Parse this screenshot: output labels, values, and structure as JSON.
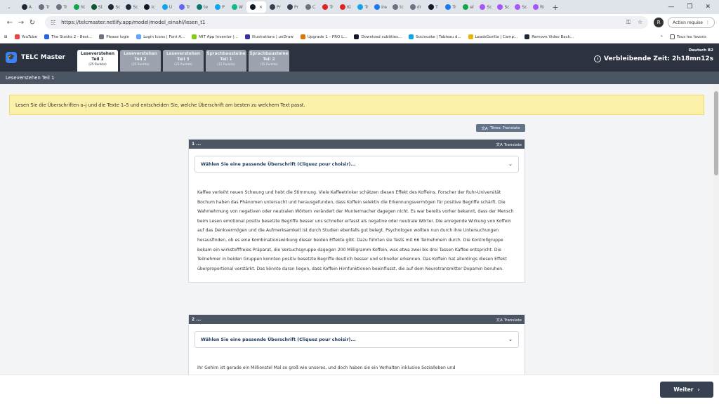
{
  "browser": {
    "tabs": [
      {
        "label": "A",
        "color": "#1f2937"
      },
      {
        "label": "Tr",
        "color": "#6b7280"
      },
      {
        "label": "Tr",
        "color": "#6b7280"
      },
      {
        "label": "ht",
        "color": "#16a34a"
      },
      {
        "label": "St",
        "color": "#14532d"
      },
      {
        "label": "Sc",
        "color": "#1f2937"
      },
      {
        "label": "Sc",
        "color": "#1f2937"
      },
      {
        "label": "Ic",
        "color": "#111827"
      },
      {
        "label": "U",
        "color": "#0ea5e9"
      },
      {
        "label": "Tr",
        "color": "#6366f1"
      },
      {
        "label": "te",
        "color": "#0f766e"
      },
      {
        "label": "P",
        "color": "#0ea5e9"
      },
      {
        "label": "W",
        "color": "#10b981"
      },
      {
        "label": "",
        "color": "#111827",
        "active": true
      },
      {
        "label": "Pr",
        "color": "#374151"
      },
      {
        "label": "Pr",
        "color": "#374151"
      },
      {
        "label": "C",
        "color": "#6b7280"
      },
      {
        "label": "Tr",
        "color": "#dc2626"
      },
      {
        "label": "Ki",
        "color": "#dc2626"
      },
      {
        "label": "Tr",
        "color": "#0ea5e9"
      },
      {
        "label": "Ire",
        "color": "#1877f2"
      },
      {
        "label": "tc",
        "color": "#6b7280"
      },
      {
        "label": "dr",
        "color": "#6b7280"
      },
      {
        "label": "T",
        "color": "#111827"
      },
      {
        "label": "Tr",
        "color": "#1877f2"
      },
      {
        "label": "el",
        "color": "#16a34a"
      },
      {
        "label": "Sc",
        "color": "#a855f7"
      },
      {
        "label": "Sc",
        "color": "#a855f7"
      },
      {
        "label": "Sc",
        "color": "#a855f7"
      },
      {
        "label": "Ri",
        "color": "#a855f7"
      }
    ],
    "new_tab": "+",
    "window_controls": [
      "—",
      "❐",
      "✕"
    ],
    "url": "https://telcmaster.netlify.app/model/model_einahl/lesen_t1",
    "profile_initial": "R",
    "action_required": "Action requise",
    "bookmarks": [
      {
        "label": "YouTube",
        "color": "#ef4444"
      },
      {
        "label": "The Stocks 2 - Best...",
        "color": "#2563eb"
      },
      {
        "label": "Please login",
        "color": "#6b7280"
      },
      {
        "label": "Login Icons | Font A...",
        "color": "#60a5fa"
      },
      {
        "label": "MIT App Inventor |...",
        "color": "#84cc16"
      },
      {
        "label": "Illustrations | unDraw",
        "color": "#3730a3"
      },
      {
        "label": "Upgrade 1 – PRO L...",
        "color": "#d97706"
      },
      {
        "label": "Download subtitles...",
        "color": "#111827"
      },
      {
        "label": "Sociocake | Tableau d...",
        "color": "#0ea5e9"
      },
      {
        "label": "LeadsGorilla | Camp...",
        "color": "#eab308"
      },
      {
        "label": "Remove Video Back...",
        "color": "#1f2937"
      }
    ],
    "bookmarks_more": "»",
    "all_bookmarks": "Tous les favoris"
  },
  "app": {
    "brand": "TELC Master",
    "tabs": [
      {
        "line1": "Leseverstehen",
        "line2": "Teil 1",
        "points": "(25 Punkte)",
        "active": true
      },
      {
        "line1": "Leseverstehen",
        "line2": "Teil 2",
        "points": "(25 Punkte)"
      },
      {
        "line1": "Leseverstehen",
        "line2": "Teil 3",
        "points": "(25 Punkte)"
      },
      {
        "line1": "Sprachbausteine",
        "line2": "Teil 1",
        "points": "(15 Punkte)"
      },
      {
        "line1": "Sprachbausteine",
        "line2": "Teil 2",
        "points": "(15 Punkte)"
      }
    ],
    "level": "Deutsch B2",
    "timer": "Verbleibende Zeit: 2h18mn12s",
    "section_title": "Leseverstehen Teil 1"
  },
  "content": {
    "instruction": "Lesen Sie die Überschriften a–j und die Texte 1–5 und entscheiden Sie, welche Überschrift am besten zu welchem Text passt.",
    "titles_translate": "Titres: Translate",
    "texts": [
      {
        "number": "1 ...",
        "translate": "Translate",
        "select_placeholder": "Wählen Sie eine passende Überschrift (Cliquez pour choisir)...",
        "body": "Kaffee verleiht neuen Schwung und hebt die Stimmung. Viele Kaffeetrinker schätzen diesen Effekt des Koffeins. Forscher der Ruhr-Universität Bochum haben das Phänomen untersucht und herausgefunden, dass Koffein selektiv die Erkennungsvermögen für positive Begriffe schärft. Die Wahrnehmung von negativen oder neutralen Wörtern verändert der Muntermacher dagegen nicht. Es war bereits vorher bekannt, dass der Mensch beim Lesen emotional positiv besetzte Begriffe besser uns schneller erfasst als negative oder neutrale Wörter. Die anregende Wirkung von Koffein auf das Denkvermögen und die Aufmerksamkeit ist durch Studien ebenfalls gut belegt. Psychologen wollten nun durch ihre Untersuchungen herausfinden, ob es eine Kombinationswirkung dieser beiden Effekte gibt. Dazu führten sie Tests mit 66 Teilnehmern durch. Die Kontrollgruppe bekam ein wirkstofffreies Präparat, die Versuchsgruppe dagegen 200 Milligramm Koffein, was etwa zwei bis drei Tassen Kaffee entspricht. Die Teilnehmer in beiden Gruppen konnten positiv besetzte Begriffe deutlich besser und schneller erkennen. Das Koffein hat allerdings diesen Effekt überproportional verstärkt. Das könnte daran liegen, dass Koffein Hirnfunktionen beeinflusst, die auf dem Neurotransmitter Dopamin beruhen."
      },
      {
        "number": "2 ...",
        "translate": "Translate",
        "select_placeholder": "Wählen Sie eine passende Überschrift (Cliquez pour choisir)...",
        "body": "Ihr Gehirn ist gerade ein Millionstel Mal so groß wie unseres, und doch haben sie ein Verhalten inklusive Sozialleben und"
      }
    ]
  },
  "footer": {
    "next": "Weiter",
    "next_icon": "›"
  }
}
